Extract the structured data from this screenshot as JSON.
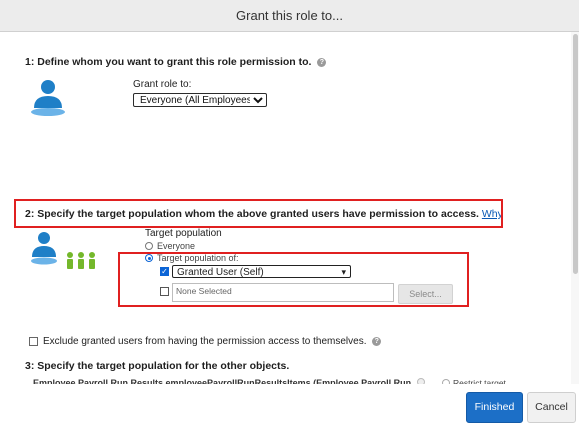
{
  "dialog": {
    "title": "Grant this role to...",
    "buttons": {
      "finished": "Finished",
      "cancel": "Cancel"
    }
  },
  "section1": {
    "heading": "1: Define whom you want to grant this role permission to.",
    "help_icon": "?",
    "grant_role_label": "Grant role to:",
    "grant_role_value": "Everyone (All Employees)",
    "grant_role_options": [
      "Everyone (All Employees)"
    ]
  },
  "section2": {
    "heading": "2: Specify the target population whom the above granted users have permission to access.",
    "why_link": "Why",
    "target_population_label": "Target population",
    "everyone_option": "Everyone",
    "target_population_of_option": "Target population of:",
    "granted_user_value": "Granted User (Self)",
    "granted_user_checked": true,
    "second_checkbox_checked": false,
    "none_selected_placeholder": "None Selected",
    "select_button": "Select..."
  },
  "exclude": {
    "label": "Exclude granted users from having the permission access to themselves.",
    "checked": false
  },
  "section3": {
    "heading": "3: Specify the target population for the other objects.",
    "object_row": "Employee Payroll Run Results.employeePayrollRunResultsItems (Employee Payroll Run",
    "restrict_label": "Restrict target"
  },
  "colors": {
    "accent": "#1c6fc7",
    "highlight": "#e02020",
    "link": "#0a59b5",
    "icon_blue": "#1f7fc7",
    "icon_green": "#74b82b"
  },
  "icons": {
    "user_icon": "person-icon",
    "group_icon": "user-group-icon"
  }
}
